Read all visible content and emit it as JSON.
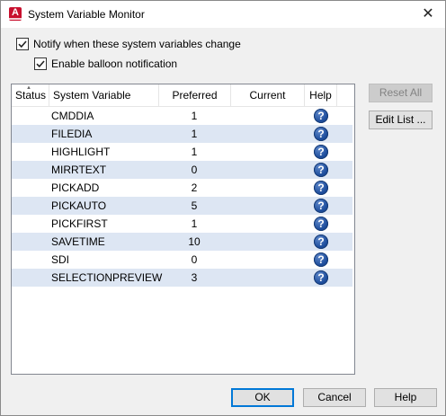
{
  "window": {
    "title": "System Variable Monitor",
    "close_glyph": "✕",
    "app_icon_letter": "A"
  },
  "options": {
    "notify_label": "Notify when these system variables change",
    "notify_checked": true,
    "balloon_label": "Enable balloon notification",
    "balloon_checked": true
  },
  "table": {
    "columns": [
      "Status",
      "System Variable",
      "Preferred",
      "Current",
      "Help"
    ],
    "rows": [
      {
        "variable": "CMDDIA",
        "preferred": "1",
        "current": ""
      },
      {
        "variable": "FILEDIA",
        "preferred": "1",
        "current": ""
      },
      {
        "variable": "HIGHLIGHT",
        "preferred": "1",
        "current": ""
      },
      {
        "variable": "MIRRTEXT",
        "preferred": "0",
        "current": ""
      },
      {
        "variable": "PICKADD",
        "preferred": "2",
        "current": ""
      },
      {
        "variable": "PICKAUTO",
        "preferred": "5",
        "current": ""
      },
      {
        "variable": "PICKFIRST",
        "preferred": "1",
        "current": ""
      },
      {
        "variable": "SAVETIME",
        "preferred": "10",
        "current": ""
      },
      {
        "variable": "SDI",
        "preferred": "0",
        "current": ""
      },
      {
        "variable": "SELECTIONPREVIEW",
        "preferred": "3",
        "current": ""
      }
    ],
    "help_icon": "help-question-icon"
  },
  "buttons": {
    "reset_all": "Reset All",
    "edit_list": "Edit List ...",
    "ok": "OK",
    "cancel": "Cancel",
    "help": "Help"
  },
  "colors": {
    "alt_row": "#dde6f3",
    "help_icon": "#1f4f9e",
    "app_icon": "#c8102e",
    "default_button_border": "#0078d7"
  }
}
